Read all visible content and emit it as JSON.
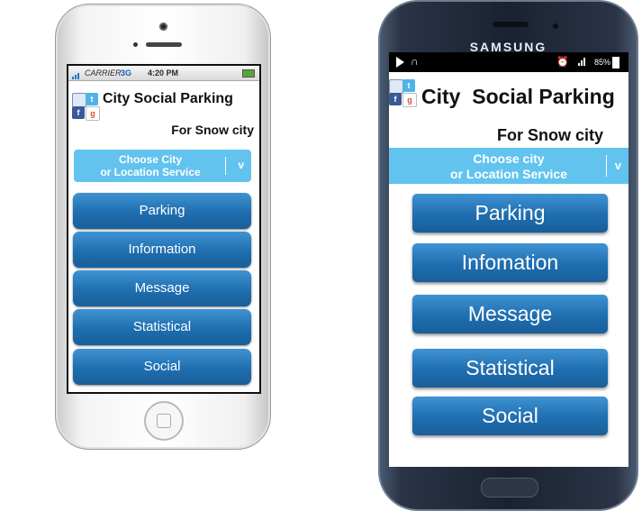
{
  "iphone": {
    "status": {
      "carrier": "CARRIER",
      "network": "3G",
      "time": "4:20 PM"
    },
    "app_title": "City Social Parking",
    "subtitle": "For Snow city",
    "chooser": {
      "line1": "Choose City",
      "line2": "or Location Service",
      "chevron": "v"
    },
    "buttons": [
      "Parking",
      "Information",
      "Message",
      "Statistical",
      "Social"
    ]
  },
  "samsung": {
    "brand": "SAMSUNG",
    "status": {
      "battery": "85%"
    },
    "app_title": "City  Social Parking",
    "subtitle": "For Snow city",
    "chooser": {
      "line1": "Choose city",
      "line2": "or Location Service",
      "chevron": "v"
    },
    "buttons": [
      "Parking",
      "Infomation",
      "Message",
      "Statistical",
      "Social"
    ]
  },
  "icons": [
    "mail-icon",
    "twitter-icon",
    "facebook-icon",
    "google-icon"
  ],
  "colors": {
    "button_blue": "#2a7fc4",
    "chooser_blue": "#62c3ee"
  }
}
